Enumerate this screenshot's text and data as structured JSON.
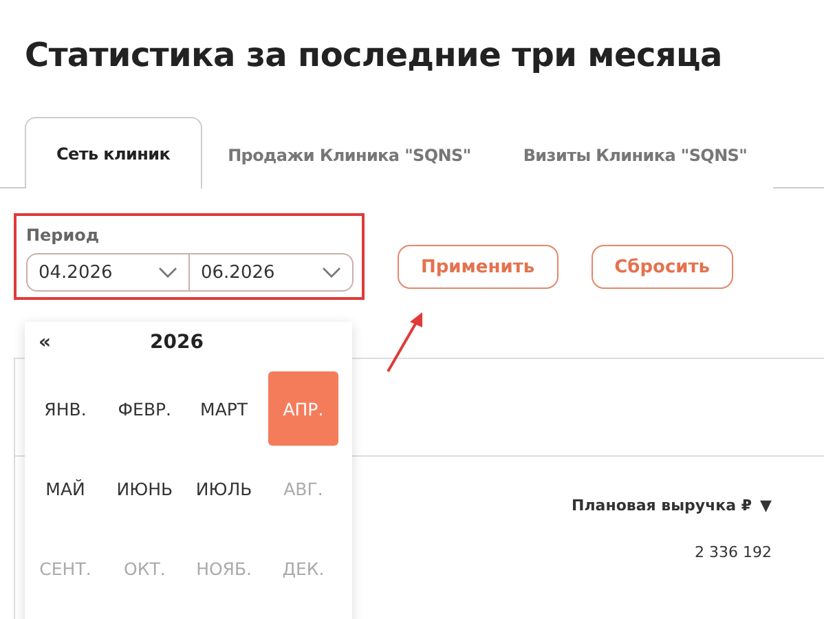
{
  "title": "Статистика за последние три месяца",
  "tabs": [
    {
      "label": "Сеть клиник",
      "selected": true
    },
    {
      "label": "Продажи Клиника \"SQNS\"",
      "selected": false
    },
    {
      "label": "Визиты Клиника \"SQNS\"",
      "selected": false
    }
  ],
  "period": {
    "label": "Период",
    "from": "04.2026",
    "to": "06.2026",
    "highlighted": true
  },
  "buttons": [
    "Применить",
    "Сбросить"
  ],
  "picker": {
    "prev": "«",
    "year": "2026",
    "months": [
      {
        "label": "ЯНВ.",
        "selected": false,
        "disabled": false
      },
      {
        "label": "ФЕВР.",
        "selected": false,
        "disabled": false
      },
      {
        "label": "МАРТ",
        "selected": false,
        "disabled": false
      },
      {
        "label": "АПР.",
        "selected": true,
        "disabled": false
      },
      {
        "label": "МАЙ",
        "selected": false,
        "disabled": false
      },
      {
        "label": "ИЮНЬ",
        "selected": false,
        "disabled": false
      },
      {
        "label": "ИЮЛЬ",
        "selected": false,
        "disabled": false
      },
      {
        "label": "АВГ.",
        "selected": false,
        "disabled": true
      },
      {
        "label": "СЕНТ.",
        "selected": false,
        "disabled": true
      },
      {
        "label": "ОКТ.",
        "selected": false,
        "disabled": true
      },
      {
        "label": "НОЯБ.",
        "selected": false,
        "disabled": true
      },
      {
        "label": "ДЕК.",
        "selected": false,
        "disabled": true
      }
    ]
  },
  "table": {
    "column": "Плановая выручка ₽",
    "sort_indicator": "▼",
    "value": "2 336 192"
  }
}
